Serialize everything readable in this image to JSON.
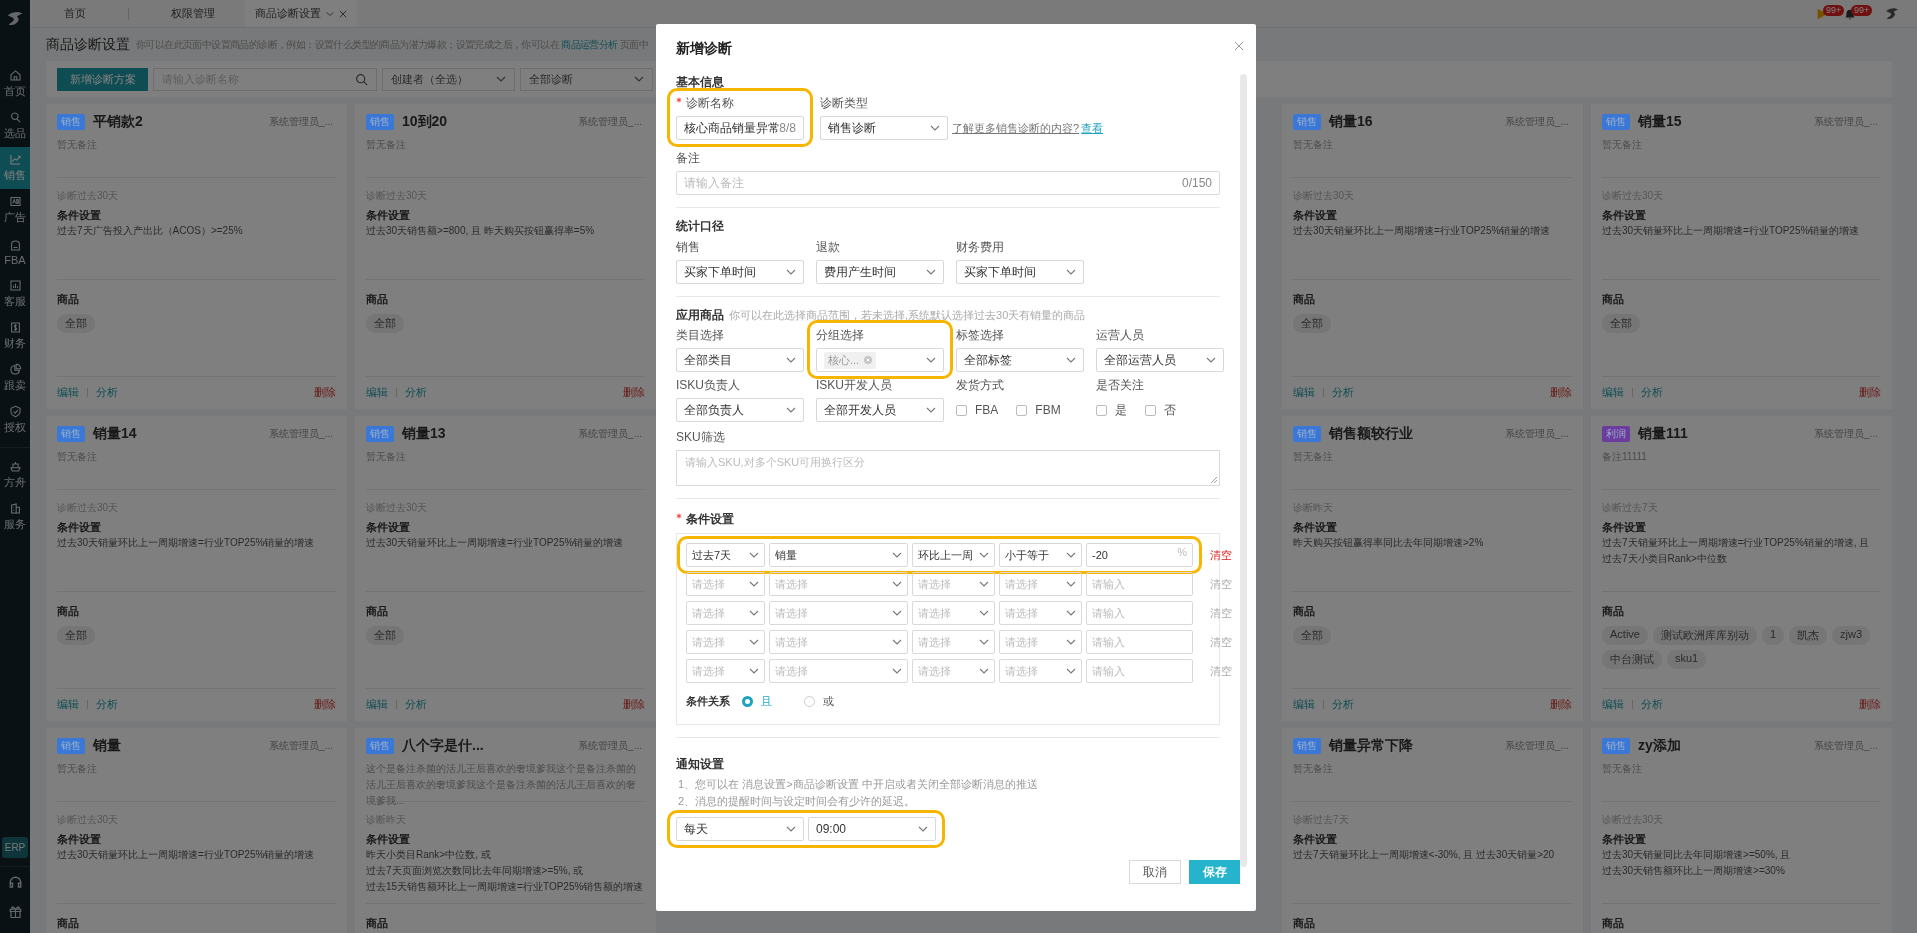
{
  "topbar": {
    "tabs": [
      {
        "label": "首页",
        "selected": false
      },
      {
        "label": "权限管理",
        "selected": false
      },
      {
        "label": "商品诊断设置",
        "selected": true
      }
    ],
    "alerts": [
      {
        "kind": "flag",
        "count": "99+"
      },
      {
        "kind": "bell",
        "count": "99+"
      }
    ]
  },
  "sidebar": {
    "items": [
      {
        "label": "首页",
        "selected": false
      },
      {
        "label": "选品",
        "selected": false
      },
      {
        "label": "销售",
        "selected": true
      },
      {
        "label": "广告",
        "selected": false
      },
      {
        "label": "FBA",
        "selected": false
      },
      {
        "label": "客服",
        "selected": false
      },
      {
        "label": "财务",
        "selected": false
      },
      {
        "label": "跟卖",
        "selected": false
      },
      {
        "label": "授权",
        "selected": false
      }
    ],
    "extra_items": [
      {
        "label": "方舟",
        "selected": false
      },
      {
        "label": "服务",
        "selected": false
      }
    ],
    "erp": "ERP"
  },
  "page": {
    "title": "商品诊断设置",
    "description": "你可以在此页面中设置商品的诊断，例如：设置什么类型的商品为潜力爆款；设置完成之后，你可以在",
    "link": "商品运营分析",
    "description_tail": "页面中"
  },
  "toolbar": {
    "add_button": "新增诊断方案",
    "search": {
      "placeholder": "请输入诊断名称"
    },
    "filters": [
      "创建者（全选）",
      "全部诊断"
    ]
  },
  "cards": [
    {
      "tag": {
        "text": "销售",
        "color": "#3a78d8"
      },
      "title": "平销款2",
      "creator": "系统管理员_...",
      "remark": "暂无备注",
      "period": "诊断过去30天",
      "condition_heading": "条件设置",
      "conditions": [
        "过去7天广告投入产出比（ACOS）>=25%"
      ],
      "products_heading": "商品",
      "products": [
        "全部"
      ],
      "actions": {
        "edit": "编辑",
        "analyze": "分析",
        "delete": "删除"
      }
    },
    {
      "tag": {
        "text": "销售",
        "color": "#3a78d8"
      },
      "title": "10到20",
      "creator": "系统管理员_...",
      "remark": "暂无备注",
      "period": "诊断过去30天",
      "condition_heading": "条件设置",
      "conditions": [
        "过去30天销售额>=800, 且 昨天购买按钮赢得率=5%"
      ],
      "products_heading": "商品",
      "products": [
        "全部"
      ],
      "actions": {
        "edit": "编辑",
        "analyze": "分析",
        "delete": "删除"
      }
    },
    {
      "tag": {
        "text": "销售",
        "color": "#3a78d8"
      },
      "title": "销量16",
      "creator": "系统管理员_...",
      "remark": "暂无备注",
      "period": "诊断过去30天",
      "condition_heading": "条件设置",
      "conditions": [
        "过去30天销量环比上一周期增速=行业TOP25%销量的增速"
      ],
      "products_heading": "商品",
      "products": [
        "全部"
      ],
      "actions": {
        "edit": "编辑",
        "analyze": "分析",
        "delete": "删除"
      }
    },
    {
      "tag": {
        "text": "销售",
        "color": "#3a78d8"
      },
      "title": "销量15",
      "creator": "系统管理员_...",
      "remark": "暂无备注",
      "period": "诊断过去30天",
      "condition_heading": "条件设置",
      "conditions": [
        "过去30天销量环比上一周期增速=行业TOP25%销量的增速"
      ],
      "products_heading": "商品",
      "products": [
        "全部"
      ],
      "actions": {
        "edit": "编辑",
        "analyze": "分析",
        "delete": "删除"
      }
    },
    {
      "tag": {
        "text": "销售",
        "color": "#3a78d8"
      },
      "title": "销量14",
      "creator": "系统管理员_...",
      "remark": "暂无备注",
      "period": "诊断过去30天",
      "condition_heading": "条件设置",
      "conditions": [
        "过去30天销量环比上一周期增速=行业TOP25%销量的增速"
      ],
      "products_heading": "商品",
      "products": [
        "全部"
      ],
      "actions": {
        "edit": "编辑",
        "analyze": "分析",
        "delete": "删除"
      }
    },
    {
      "tag": {
        "text": "销售",
        "color": "#3a78d8"
      },
      "title": "销量13",
      "creator": "系统管理员_...",
      "remark": "暂无备注",
      "period": "诊断过去30天",
      "condition_heading": "条件设置",
      "conditions": [
        "过去30天销量环比上一周期增速=行业TOP25%销量的增速"
      ],
      "products_heading": "商品",
      "products": [
        "全部"
      ],
      "actions": {
        "edit": "编辑",
        "analyze": "分析",
        "delete": "删除"
      }
    },
    {
      "tag": {
        "text": "销售",
        "color": "#3a78d8"
      },
      "title": "销售额较行业",
      "creator": "系统管理员_...",
      "remark": "暂无备注",
      "period": "诊断昨天",
      "condition_heading": "条件设置",
      "conditions": [
        "昨天购买按钮赢得率同比去年同期增速>2%"
      ],
      "products_heading": "商品",
      "products": [
        "全部"
      ],
      "actions": {
        "edit": "编辑",
        "analyze": "分析",
        "delete": "删除"
      }
    },
    {
      "tag": {
        "text": "利润",
        "color": "#6a3c9e"
      },
      "title": "销量111",
      "creator": "系统管理员_...",
      "remark": "备注11111",
      "period": "诊断过去7天",
      "condition_heading": "条件设置",
      "conditions": [
        "过去7天销量环比上一周期增速=行业TOP25%销量的增速, 且",
        "过去7天小类目Rank>中位数"
      ],
      "products_heading": "商品",
      "products": [
        "Active",
        "测试欧洲库库别动",
        "1",
        "凯杰",
        "zjw3",
        "中台测试",
        "sku1"
      ],
      "actions": {
        "edit": "编辑",
        "analyze": "分析",
        "delete": "删除"
      }
    },
    {
      "tag": {
        "text": "销售",
        "color": "#3a78d8"
      },
      "title": "销量",
      "creator": "系统管理员_...",
      "remark": "暂无备注",
      "period": "诊断过去30天",
      "condition_heading": "条件设置",
      "conditions": [
        "过去30天销量环比上一周期增速=行业TOP25%销量的增速"
      ],
      "products_heading": "商品"
    },
    {
      "tag": {
        "text": "销售",
        "color": "#3a78d8"
      },
      "title": "八个字是什...",
      "creator": "系统管理员_...",
      "remark": "这个是备注杀菌的活儿王后喜欢的奢境爹我这个是备注杀菌的活儿王后喜欢的奢境爹我这个是备注杀菌的活儿王后喜欢的奢境爹我...",
      "period": "诊断昨天",
      "condition_heading": "条件设置",
      "conditions": [
        "昨天小类目Rank>中位数, 或",
        "过去7天页面浏览次数同比去年同期增速>=5%, 或",
        "过去15天销售额环比上一周期增速=行业TOP25%销售额的增速"
      ],
      "products_heading": "商品"
    },
    {
      "tag": {
        "text": "销售",
        "color": "#3a78d8"
      },
      "title": "销量异常下降",
      "creator": "系统管理员_...",
      "remark": "暂无备注",
      "period": "诊断过去7天",
      "condition_heading": "条件设置",
      "conditions": [
        "过去7天销量环比上一周期增速<-30%, 且 过去30天销量>20"
      ],
      "products_heading": "商品"
    },
    {
      "tag": {
        "text": "销售",
        "color": "#3a78d8"
      },
      "title": "zy添加",
      "creator": "系统管理员_...",
      "remark": "暂无备注",
      "period": "诊断过去30天",
      "condition_heading": "条件设置",
      "conditions": [
        "过去30天销量同比去年同期增速>=50%, 且",
        "过去30天销售额环比上一周期增速>=30%"
      ],
      "products_heading": "商品"
    }
  ],
  "dialog": {
    "title": "新增诊断",
    "basic": {
      "heading": "基本信息",
      "name": {
        "label": "诊断名称",
        "required": true,
        "value": "核心商品销量异常",
        "count": "8/8",
        "highlighted": true
      },
      "type": {
        "label": "诊断类型",
        "value": "销售诊断"
      },
      "help": "了解更多销售诊断的内容?",
      "help_link": "查看",
      "remark": {
        "label": "备注",
        "placeholder": "请输入备注",
        "count": "0/150"
      }
    },
    "stats": {
      "heading": "统计口径",
      "selects": [
        {
          "label": "销售",
          "value": "买家下单时间"
        },
        {
          "label": "退款",
          "value": "费用产生时间"
        },
        {
          "label": "财务费用",
          "value": "买家下单时间"
        }
      ]
    },
    "scope": {
      "heading": "应用商品",
      "hint": "你可以在此选择商品范围，若未选择,系统默认选择过去30天有销量的商品",
      "fields": [
        {
          "kind": "select",
          "label": "类目选择",
          "value": "全部类目",
          "highlighted": false
        },
        {
          "kind": "tags",
          "label": "分组选择",
          "tags": [
            "核心..."
          ],
          "highlighted": true
        },
        {
          "kind": "select",
          "label": "标签选择",
          "value": "全部标签",
          "highlighted": false
        },
        {
          "kind": "select",
          "label": "运营人员",
          "value": "全部运营人员",
          "highlighted": false
        },
        {
          "kind": "select",
          "label": "ISKU负责人",
          "value": "全部负责人",
          "highlighted": false
        },
        {
          "kind": "select",
          "label": "ISKU开发人员",
          "value": "全部开发人员",
          "highlighted": false
        },
        {
          "kind": "checks",
          "label": "发货方式",
          "options": [
            {
              "label": "FBA",
              "checked": false
            },
            {
              "label": "FBM",
              "checked": false
            }
          ],
          "highlighted": false
        },
        {
          "kind": "checks",
          "label": "是否关注",
          "options": [
            {
              "label": "是",
              "checked": false
            },
            {
              "label": "否",
              "checked": false
            }
          ],
          "highlighted": false
        }
      ],
      "sku": {
        "label": "SKU筛选",
        "placeholder": "请输入SKU,对多个SKU可用换行区分"
      }
    },
    "conditions": {
      "heading": "条件设置",
      "required": true,
      "rows": [
        {
          "cells": [
            {
              "kind": "select",
              "value": "过去7天"
            },
            {
              "kind": "select",
              "value": "销量"
            },
            {
              "kind": "select",
              "value": "环比上一周"
            },
            {
              "kind": "select",
              "value": "小于等于"
            },
            {
              "kind": "input",
              "value": "-20",
              "suffix": "%"
            }
          ],
          "clear": "清空",
          "active": true,
          "highlighted": true
        },
        {
          "cells": [
            {
              "kind": "select",
              "placeholder": "请选择"
            },
            {
              "kind": "select",
              "placeholder": "请选择"
            },
            {
              "kind": "select",
              "placeholder": "请选择"
            },
            {
              "kind": "select",
              "placeholder": "请选择"
            },
            {
              "kind": "input",
              "placeholder": "请输入"
            }
          ],
          "clear": "清空",
          "active": false,
          "highlighted": false
        },
        {
          "cells": [
            {
              "kind": "select",
              "placeholder": "请选择"
            },
            {
              "kind": "select",
              "placeholder": "请选择"
            },
            {
              "kind": "select",
              "placeholder": "请选择"
            },
            {
              "kind": "select",
              "placeholder": "请选择"
            },
            {
              "kind": "input",
              "placeholder": "请输入"
            }
          ],
          "clear": "清空",
          "active": false,
          "highlighted": false
        },
        {
          "cells": [
            {
              "kind": "select",
              "placeholder": "请选择"
            },
            {
              "kind": "select",
              "placeholder": "请选择"
            },
            {
              "kind": "select",
              "placeholder": "请选择"
            },
            {
              "kind": "select",
              "placeholder": "请选择"
            },
            {
              "kind": "input",
              "placeholder": "请输入"
            }
          ],
          "clear": "清空",
          "active": false,
          "highlighted": false
        },
        {
          "cells": [
            {
              "kind": "select",
              "placeholder": "请选择"
            },
            {
              "kind": "select",
              "placeholder": "请选择"
            },
            {
              "kind": "select",
              "placeholder": "请选择"
            },
            {
              "kind": "select",
              "placeholder": "请选择"
            },
            {
              "kind": "input",
              "placeholder": "请输入"
            }
          ],
          "clear": "清空",
          "active": false,
          "highlighted": false
        }
      ],
      "relation": {
        "label": "条件关系",
        "options": [
          {
            "label": "且",
            "selected": true
          },
          {
            "label": "或",
            "selected": false
          }
        ]
      }
    },
    "notify": {
      "heading": "通知设置",
      "notes": [
        "1、您可以在 消息设置>商品诊断设置 中开启或者关闭全部诊断消息的推送",
        "2、消息的提醒时间与设定时间会有少许的延迟。"
      ],
      "selects": [
        "每天",
        "09:00"
      ],
      "highlighted": true
    },
    "footer": {
      "cancel": "取消",
      "save": "保存"
    }
  }
}
